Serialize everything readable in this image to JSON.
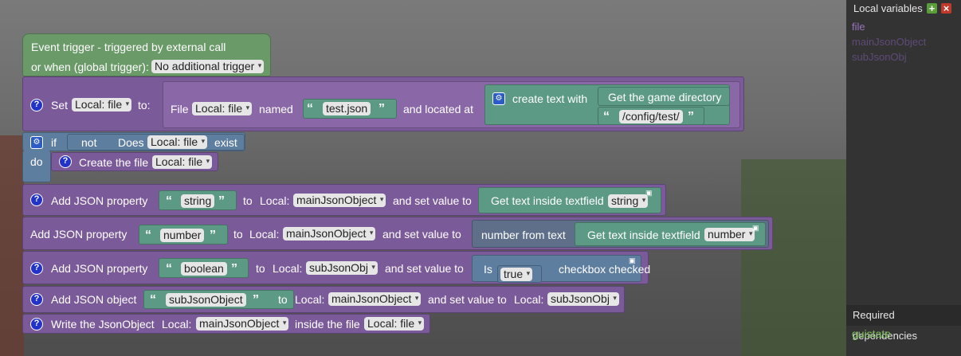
{
  "event": {
    "title": "Event trigger - triggered by external call",
    "or_when": "or when (global trigger):",
    "trigger_value": "No additional trigger"
  },
  "set_block": {
    "set": "Set",
    "var": "Local: file",
    "to": "to:",
    "file": "File",
    "file_var": "Local: file",
    "named": "named",
    "name_value": "test.json",
    "located_at": "and located at",
    "create_text": "create text with",
    "game_dir": "Get the game directory",
    "path_value": "/config/test/"
  },
  "if_block": {
    "if": "if",
    "not": "not",
    "does": "Does",
    "does_var": "Local: file",
    "exist": "exist",
    "do": "do",
    "create_file": "Create the file",
    "create_var": "Local: file"
  },
  "rows": {
    "r1": {
      "add": "Add JSON property",
      "key": "string",
      "to": "to",
      "local": "Local:",
      "target": "mainJsonObject",
      "set": "and set value to",
      "getter": "Get text inside textfield",
      "field": "string"
    },
    "r2": {
      "add": "Add JSON property",
      "key": "number",
      "to": "to",
      "local": "Local:",
      "target": "mainJsonObject",
      "set": "and set value to",
      "conv": "number from text",
      "getter": "Get text inside textfield",
      "field": "number"
    },
    "r3": {
      "add": "Add JSON property",
      "key": "boolean",
      "to": "to",
      "local": "Local:",
      "target": "subJsonObj",
      "set": "and set value to",
      "is": "Is",
      "check": "checkbox checked",
      "val": "true"
    },
    "r4": {
      "add": "Add JSON object",
      "key": "subJsonObject",
      "to": "to",
      "local": "Local:",
      "target": "mainJsonObject",
      "set": "and set value to",
      "local2": "Local:",
      "val": "subJsonObj"
    },
    "r5": {
      "write": "Write the JsonObject",
      "local": "Local:",
      "target": "mainJsonObject",
      "inside": "inside the file",
      "file": "Local: file"
    }
  },
  "panel": {
    "title": "Local variables",
    "variables": [
      "file",
      "mainJsonObject",
      "subJsonObj"
    ],
    "deps_title": "Required dependencies",
    "deps": [
      "guistate"
    ]
  },
  "colors": {
    "purple": "#7b5a9a",
    "green": "#6a9a68",
    "teal": "#5c9a86",
    "blue": "#5e7ea0"
  },
  "icons": [
    "help-icon",
    "gear-icon",
    "add-icon",
    "close-icon",
    "monitor-icon"
  ]
}
